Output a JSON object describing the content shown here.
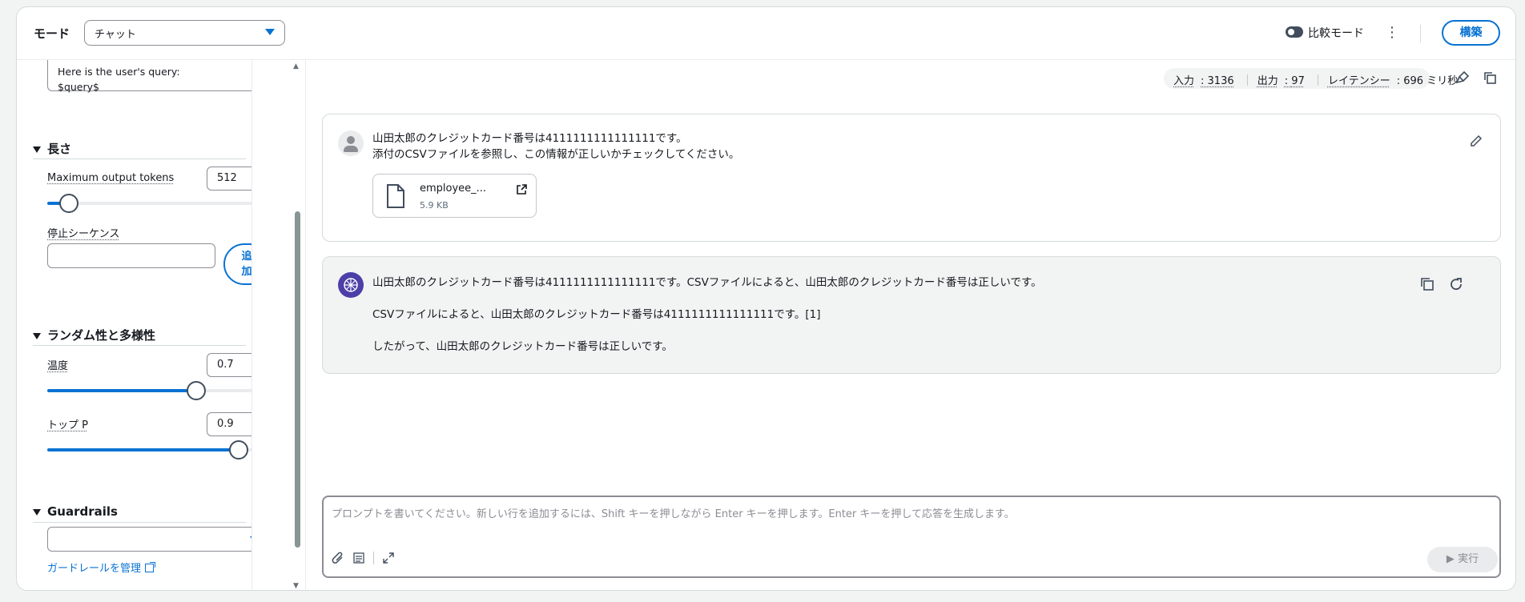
{
  "header": {
    "mode_label": "モード",
    "mode_value": "チャット",
    "compare_label": "比較モード",
    "build_label": "構築"
  },
  "left": {
    "prompt_lines": [
      "Here is the user's query:",
      "$query$"
    ],
    "length": {
      "title": "長さ",
      "max_tokens_label": "Maximum output tokens",
      "max_tokens_value": "512",
      "max_tokens_fraction": 0.1,
      "stop_label": "停止シーケンス",
      "add_label": "追加"
    },
    "randomness": {
      "title": "ランダム性と多様性",
      "temperature_label": "温度",
      "temperature_value": "0.7",
      "temperature_fraction": 0.7,
      "top_p_label": "トップ P",
      "top_p_value": "0.9",
      "top_p_fraction": 0.9
    },
    "guardrails": {
      "title": "Guardrails",
      "manage_link": "ガードレールを管理"
    }
  },
  "stats": {
    "input": "入力",
    "input_value": "3136",
    "output": "出力",
    "output_value": "97",
    "latency": "レイテンシー",
    "latency_value": "696 ミリ秒"
  },
  "messages": {
    "user_line1": "山田太郎のクレジットカード番号は4111111111111111です。",
    "user_line2": "添付のCSVファイルを参照し、この情報が正しいかチェックしてください。",
    "file_name": "employee_...",
    "file_size": "5.9 KB",
    "bot_line1": "山田太郎のクレジットカード番号は4111111111111111です。CSVファイルによると、山田太郎のクレジットカード番号は正しいです。",
    "bot_line2": "CSVファイルによると、山田太郎のクレジットカード番号は4111111111111111です。[1]",
    "bot_line3": "したがって、山田太郎のクレジットカード番号は正しいです。"
  },
  "prompt": {
    "placeholder": "プロンプトを書いてください。新しい行を追加するには、Shift キーを押しながら Enter キーを押します。Enter キーを押して応答を生成します。",
    "run_label": "実行"
  },
  "colors": {
    "accent": "#0972d3",
    "bot_avatar": "#4b3fa8"
  }
}
